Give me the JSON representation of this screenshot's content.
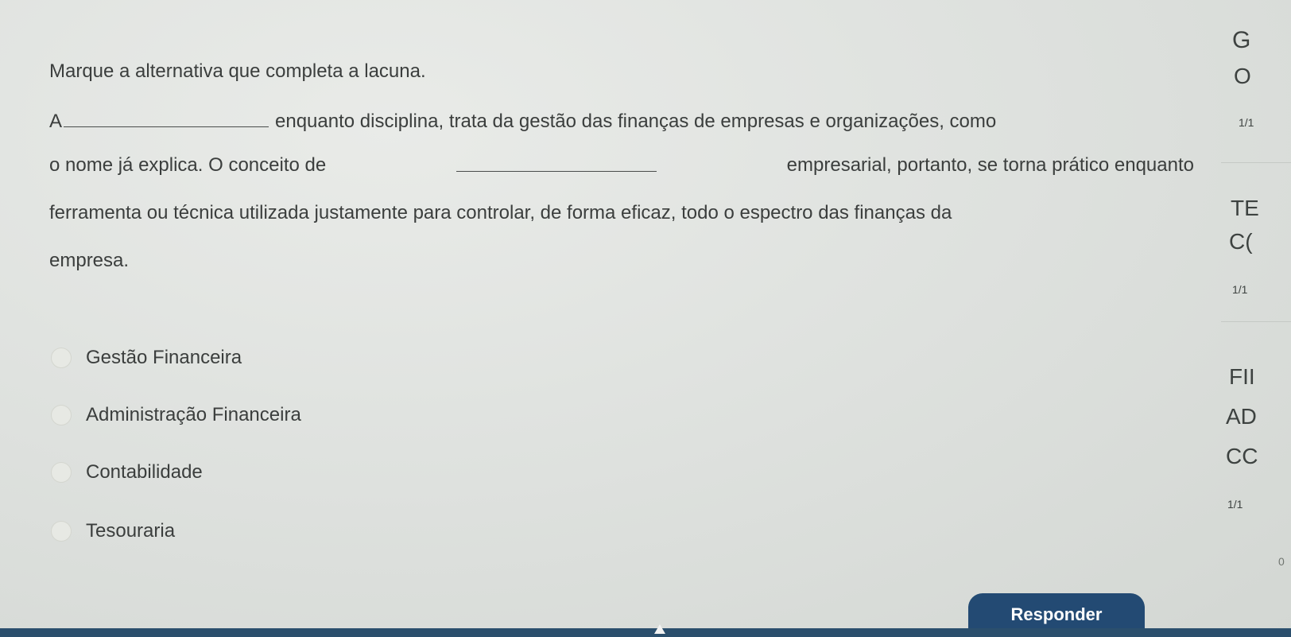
{
  "question": {
    "title": "Marque a alternativa que completa a lacuna.",
    "line1_start": "A",
    "line1_end": "enquanto disciplina, trata da gestão das finanças de empresas e organizações, como",
    "line2_start": "o nome já explica. O conceito de",
    "line2_end": "empresarial, portanto, se torna prático enquanto",
    "line3": "ferramenta ou técnica utilizada justamente para controlar, de forma eficaz, todo o espectro das finanças da",
    "line4": "empresa."
  },
  "options": [
    {
      "label": "Gestão Financeira"
    },
    {
      "label": "Administração Financeira"
    },
    {
      "label": "Contabilidade"
    },
    {
      "label": "Tesouraria"
    }
  ],
  "submit_label": "Responder",
  "sidebar": {
    "g": "G",
    "o": "O",
    "count1": "1/1",
    "te": "TE",
    "c1": "C(",
    "count2": "1/1",
    "fi": "FII",
    "ad": "AD",
    "cc": "CC",
    "count3": "1/1",
    "zero": "0"
  },
  "colors": {
    "button_bg": "#234a73",
    "background": "#dfe2df",
    "text": "#3b3e3d"
  }
}
